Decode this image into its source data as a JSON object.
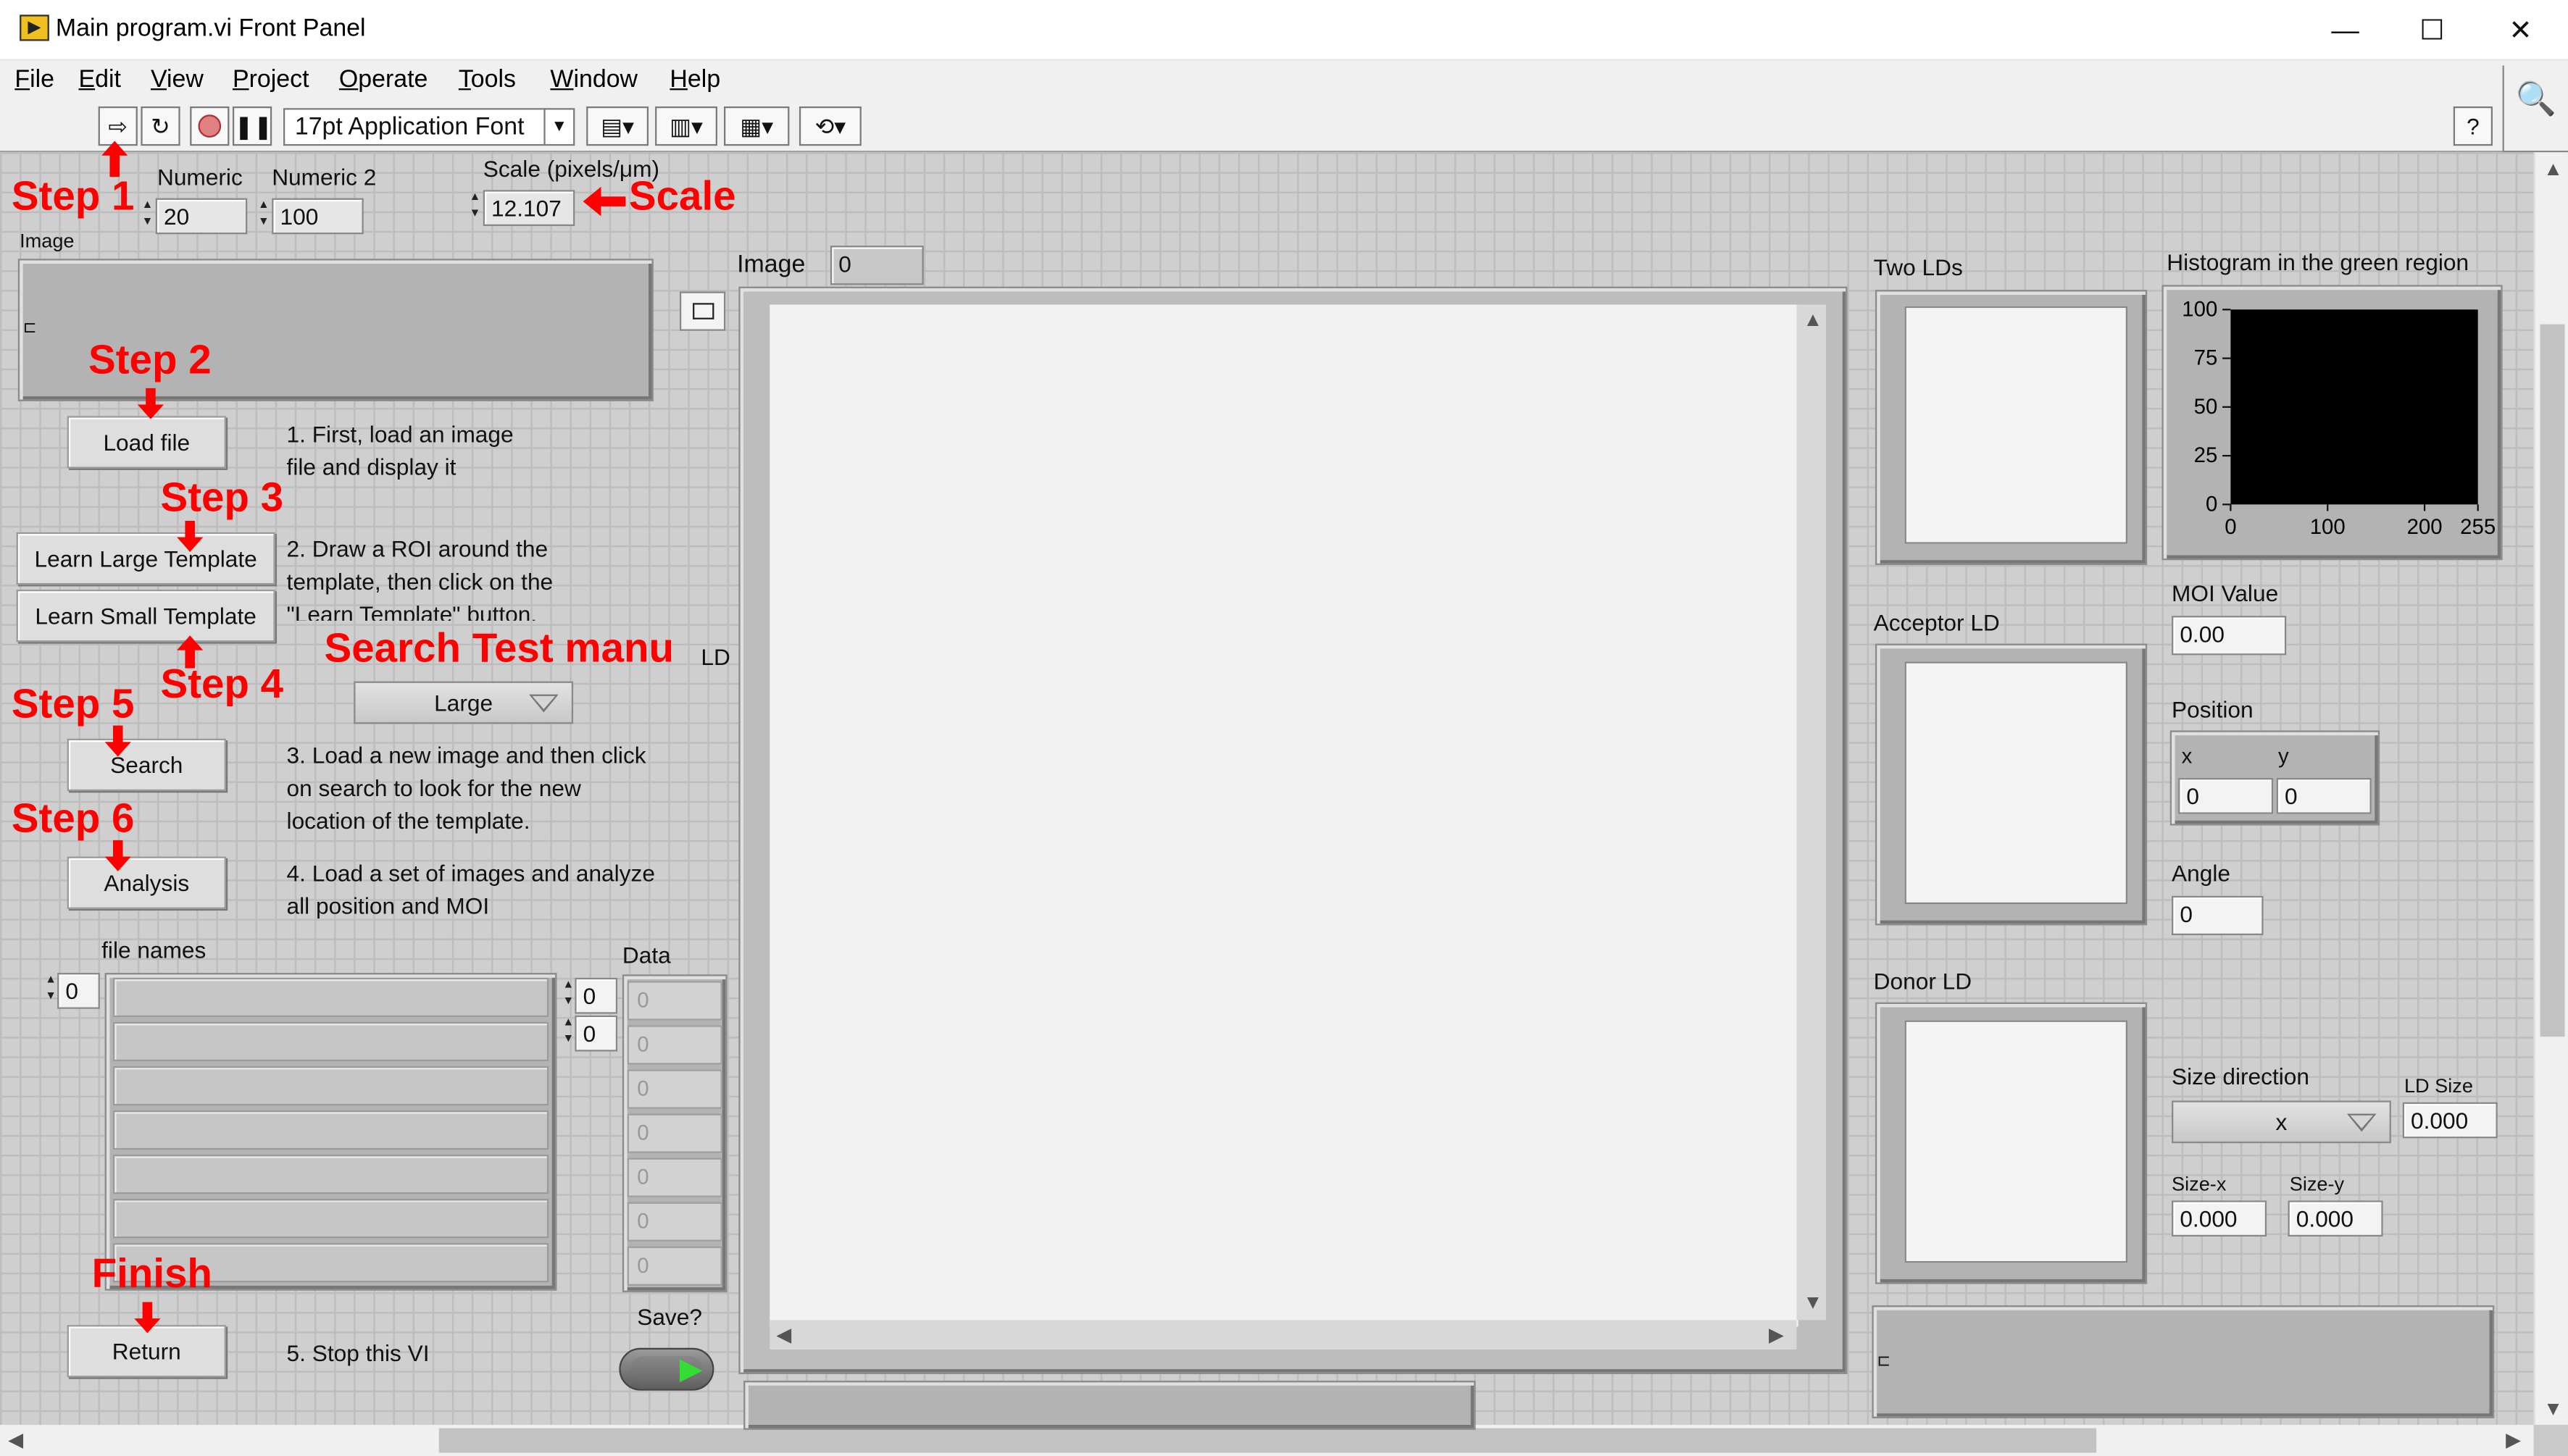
{
  "window": {
    "title": "Main program.vi Front Panel",
    "minimize": "—",
    "maximize": "☐",
    "close": "✕"
  },
  "menu": [
    {
      "key": "F",
      "rest": "ile"
    },
    {
      "key": "E",
      "rest": "dit"
    },
    {
      "key": "V",
      "rest": "iew"
    },
    {
      "key": "P",
      "rest": "roject"
    },
    {
      "key": "O",
      "rest": "perate"
    },
    {
      "key": "T",
      "rest": "ools"
    },
    {
      "key": "W",
      "rest": "indow"
    },
    {
      "key": "H",
      "rest": "elp"
    }
  ],
  "toolbar": {
    "font": "17pt Application Font",
    "help": "?"
  },
  "controls": {
    "numeric_label": "Numeric",
    "numeric_value": "20",
    "numeric2_label": "Numeric 2",
    "numeric2_value": "100",
    "scale_label": "Scale (pixels/μm)",
    "scale_value": "12.107",
    "image_path_label": "Image",
    "load_file": "Load file",
    "learn_large": "Learn Large Template",
    "learn_small": "Learn Small Template",
    "search_ring_value": "Large",
    "search_ring_label_suffix": "LD",
    "search": "Search",
    "analysis": "Analysis",
    "file_names_label": "file names",
    "file_index": "0",
    "data_label": "Data",
    "data_index_1": "0",
    "data_index_2": "0",
    "data_values": [
      "0",
      "0",
      "0",
      "0",
      "0",
      "0",
      "0"
    ],
    "save_label": "Save?",
    "return": "Return",
    "image_display_label": "Image",
    "image_display_value": "0"
  },
  "notes": {
    "n1_line1": "1. First, load an image",
    "n1_line2": "file and display it",
    "n2_line1": "2. Draw a ROI around the",
    "n2_line2": "template,  then click on the",
    "n2_line3": "\"Learn Template\" button.",
    "n3_line1": "3. Load a new image and then click",
    "n3_line2": "on search to look for the new",
    "n3_line3": "location of the template.",
    "n4_line1": "4. Load a set of images and analyze",
    "n4_line2": "all position and MOI",
    "n5": "5. Stop this VI"
  },
  "annotations": {
    "step1": "Step 1",
    "step2": "Step 2",
    "step3": "Step 3",
    "step4": "Step 4",
    "step5": "Step 5",
    "step6": "Step 6",
    "finish": "Finish",
    "scale": "Scale",
    "search_test": "Search Test manu"
  },
  "right_panel": {
    "two_lds": "Two LDs",
    "acceptor_ld": "Acceptor LD",
    "donor_ld": "Donor LD",
    "histogram_title": "Histogram in the green region",
    "moi_label": "MOI Value",
    "moi_value": "0.00",
    "position_label": "Position",
    "pos_x_label": "x",
    "pos_y_label": "y",
    "pos_x_value": "0",
    "pos_y_value": "0",
    "angle_label": "Angle",
    "angle_value": "0",
    "size_direction_label": "Size direction",
    "size_direction_value": "x",
    "ld_size_label": "LD Size",
    "ld_size_value": "0.000",
    "size_x_label": "Size-x",
    "size_x_value": "0.000",
    "size_y_label": "Size-y",
    "size_y_value": "0.000"
  },
  "chart_data": {
    "type": "bar",
    "title": "Histogram in the green region",
    "xlim": [
      0,
      255
    ],
    "ylim": [
      0,
      100
    ],
    "xticks": [
      "0",
      "100",
      "200",
      "255"
    ],
    "yticks": [
      "100",
      "75",
      "50",
      "25",
      "0"
    ],
    "background": "#000000",
    "values": []
  },
  "colors": {
    "annotation": "#ff0000",
    "panel_bg": "#cfcfcf",
    "grid": "#bdbdbd"
  }
}
